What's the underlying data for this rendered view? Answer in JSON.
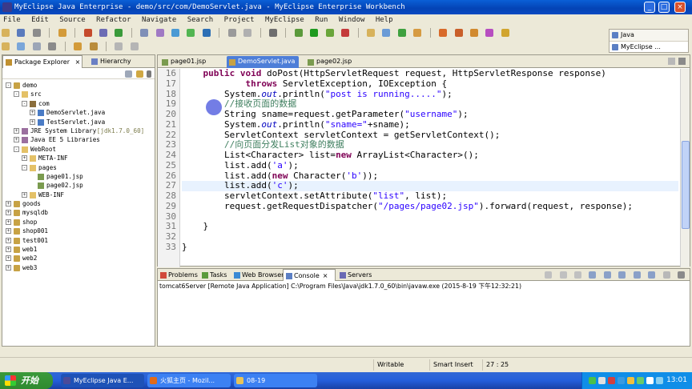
{
  "window": {
    "title": "MyEclipse Java Enterprise - demo/src/com/DemoServlet.java - MyEclipse Enterprise Workbench"
  },
  "menu": [
    "File",
    "Edit",
    "Source",
    "Refactor",
    "Navigate",
    "Search",
    "Project",
    "MyEclipse",
    "Run",
    "Window",
    "Help"
  ],
  "perspectives": [
    {
      "label": "Java"
    },
    {
      "label": "MyEclipse ..."
    }
  ],
  "left_pane": {
    "tabs": [
      {
        "label": "Package Explorer"
      },
      {
        "label": "Hierarchy"
      }
    ],
    "tree": [
      {
        "label": "demo",
        "depth": 0,
        "icon": "proj",
        "toggle": "-"
      },
      {
        "label": "src",
        "depth": 1,
        "icon": "folder",
        "toggle": "-"
      },
      {
        "label": "com",
        "depth": 2,
        "icon": "pkg",
        "toggle": "-"
      },
      {
        "label": "DemoServlet.java",
        "depth": 3,
        "icon": "java",
        "toggle": "+"
      },
      {
        "label": "TestServlet.java",
        "depth": 3,
        "icon": "java",
        "toggle": "+"
      },
      {
        "label": "JRE System Library",
        "suffix": " [jdk1.7.0_60]",
        "depth": 1,
        "icon": "lib",
        "toggle": "+"
      },
      {
        "label": "Java EE 5 Libraries",
        "depth": 1,
        "icon": "lib",
        "toggle": "+"
      },
      {
        "label": "WebRoot",
        "depth": 1,
        "icon": "folder",
        "toggle": "-"
      },
      {
        "label": "META-INF",
        "depth": 2,
        "icon": "folder",
        "toggle": "+"
      },
      {
        "label": "pages",
        "depth": 2,
        "icon": "folder",
        "toggle": "-"
      },
      {
        "label": "page01.jsp",
        "depth": 3,
        "icon": "jsp",
        "toggle": ""
      },
      {
        "label": "page02.jsp",
        "depth": 3,
        "icon": "jsp",
        "toggle": ""
      },
      {
        "label": "WEB-INF",
        "depth": 2,
        "icon": "folder",
        "toggle": "+"
      },
      {
        "label": "goods",
        "depth": 0,
        "icon": "proj",
        "toggle": "+"
      },
      {
        "label": "mysqldb",
        "depth": 0,
        "icon": "proj",
        "toggle": "+"
      },
      {
        "label": "shop",
        "depth": 0,
        "icon": "proj",
        "toggle": "+"
      },
      {
        "label": "shop001",
        "depth": 0,
        "icon": "proj",
        "toggle": "+"
      },
      {
        "label": "test001",
        "depth": 0,
        "icon": "proj",
        "toggle": "+"
      },
      {
        "label": "web1",
        "depth": 0,
        "icon": "proj",
        "toggle": "+"
      },
      {
        "label": "web2",
        "depth": 0,
        "icon": "proj",
        "toggle": "+"
      },
      {
        "label": "web3",
        "depth": 0,
        "icon": "proj",
        "toggle": "+"
      }
    ]
  },
  "editor": {
    "tabs": [
      {
        "label": "page01.jsp",
        "active": false
      },
      {
        "label": "DemoServlet.java",
        "active": true
      },
      {
        "label": "page02.jsp",
        "active": false
      }
    ],
    "current_line": 27,
    "lines": [
      {
        "n": "16",
        "tokens": [
          [
            "",
            "    "
          ],
          [
            "kw",
            "public void"
          ],
          [
            "",
            " doPost(HttpServletRequest request, HttpServletResponse response)"
          ]
        ]
      },
      {
        "n": "17",
        "tokens": [
          [
            "",
            "            "
          ],
          [
            "kw",
            "throws"
          ],
          [
            "",
            " ServletException, IOException {"
          ]
        ]
      },
      {
        "n": "18",
        "tokens": [
          [
            "",
            "        System."
          ],
          [
            "fd",
            "out"
          ],
          [
            "",
            ".println("
          ],
          [
            "st",
            "\"post is running.....\""
          ],
          [
            "",
            ");"
          ]
        ]
      },
      {
        "n": "19",
        "tokens": [
          [
            "",
            "        "
          ],
          [
            "cm",
            "//接收页面的数据"
          ]
        ]
      },
      {
        "n": "20",
        "tokens": [
          [
            "",
            "        String sname=request.getParameter("
          ],
          [
            "st",
            "\"username\""
          ],
          [
            "",
            ");"
          ]
        ]
      },
      {
        "n": "21",
        "tokens": [
          [
            "",
            "        System."
          ],
          [
            "fd",
            "out"
          ],
          [
            "",
            ".println("
          ],
          [
            "st",
            "\"sname=\""
          ],
          [
            "",
            "+sname);"
          ]
        ]
      },
      {
        "n": "22",
        "tokens": [
          [
            "",
            "        ServletContext servletContext = getServletContext();"
          ]
        ]
      },
      {
        "n": "23",
        "tokens": [
          [
            "",
            "        "
          ],
          [
            "cm",
            "//向页面分发List对象的数据"
          ]
        ]
      },
      {
        "n": "24",
        "tokens": [
          [
            "",
            "        List<Character> list="
          ],
          [
            "kw",
            "new"
          ],
          [
            "",
            " ArrayList<Character>();"
          ]
        ]
      },
      {
        "n": "25",
        "tokens": [
          [
            "",
            "        list.add("
          ],
          [
            "st",
            "'a'"
          ],
          [
            "",
            ");"
          ]
        ]
      },
      {
        "n": "26",
        "tokens": [
          [
            "",
            "        list.add("
          ],
          [
            "kw",
            "new"
          ],
          [
            "",
            " Character("
          ],
          [
            "st",
            "'b'"
          ],
          [
            "",
            "));"
          ]
        ]
      },
      {
        "n": "27",
        "tokens": [
          [
            "",
            "        list.add("
          ],
          [
            "st",
            "'c'"
          ],
          [
            "",
            ");"
          ]
        ]
      },
      {
        "n": "28",
        "tokens": [
          [
            "",
            "        servletContext.setAttribute("
          ],
          [
            "st",
            "\"list\""
          ],
          [
            "",
            ", list);"
          ]
        ]
      },
      {
        "n": "29",
        "tokens": [
          [
            "",
            "        request.getRequestDispatcher("
          ],
          [
            "st",
            "\"/pages/page02.jsp\""
          ],
          [
            "",
            ").forward(request, response);"
          ]
        ]
      },
      {
        "n": "30",
        "tokens": [
          [
            "",
            ""
          ]
        ]
      },
      {
        "n": "31",
        "tokens": [
          [
            "",
            "    }"
          ]
        ]
      },
      {
        "n": "32",
        "tokens": [
          [
            "",
            ""
          ]
        ]
      },
      {
        "n": "33",
        "tokens": [
          [
            "",
            "}"
          ]
        ]
      }
    ]
  },
  "console": {
    "tabs": [
      {
        "label": "Problems"
      },
      {
        "label": "Tasks"
      },
      {
        "label": "Web Browser"
      },
      {
        "label": "Console",
        "active": true
      },
      {
        "label": "Servers"
      }
    ],
    "header": "tomcat6Server [Remote Java Application] C:\\Program Files\\Java\\jdk1.7.0_60\\bin\\javaw.exe (2015-8-19 下午12:32:21)"
  },
  "status": {
    "writable": "Writable",
    "insert": "Smart Insert",
    "position": "27 : 25"
  },
  "taskbar": {
    "start": "开始",
    "tasks": [
      {
        "label": "MyEclipse Java E...",
        "active": true
      },
      {
        "label": "火狐主页 - Mozil...",
        "active": false
      },
      {
        "label": "08-19",
        "active": false
      }
    ],
    "clock": "13:01"
  },
  "colors": {
    "keyword": "#7f0055",
    "comment": "#3f7f5f",
    "string": "#2a00ff",
    "field": "#0000c0",
    "current_line": "#e8f2fe",
    "titlebar": "#0443b5"
  }
}
